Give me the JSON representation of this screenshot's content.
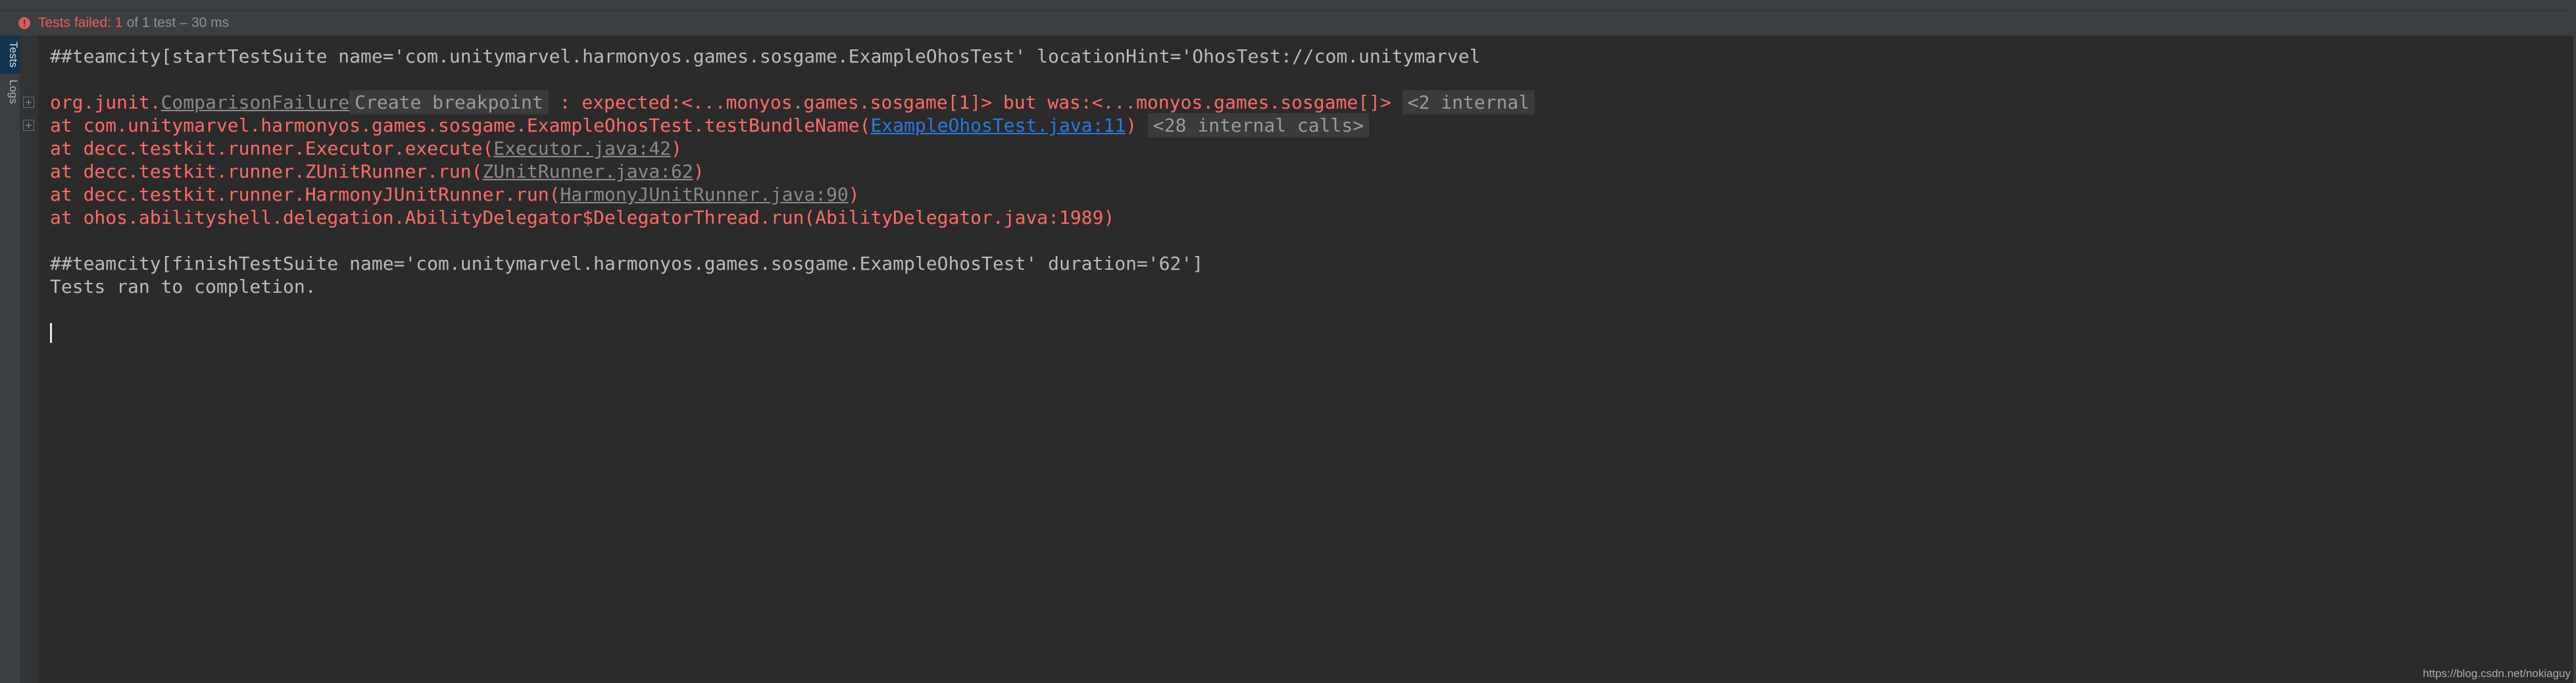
{
  "status": {
    "icon": "error-circle-icon",
    "failed_label": "Tests failed:",
    "count": "1",
    "of_label": "of 1 test",
    "dash": "–",
    "duration": "30 ms"
  },
  "tool_strip": {
    "tabs": [
      {
        "label": "Tests",
        "selected": true
      },
      {
        "label": "Logs",
        "selected": false
      }
    ]
  },
  "console": {
    "lines": [
      {
        "fold": false,
        "segments": [
          {
            "kind": "out",
            "text": "##teamcity[startTestSuite name='com.unitymarvel.harmonyos.games.sosgame.ExampleOhosTest' locationHint='OhosTest://com.unitymarvel"
          }
        ]
      },
      {
        "fold": false,
        "segments": [
          {
            "kind": "blank",
            "text": " "
          }
        ]
      },
      {
        "fold": true,
        "segments": [
          {
            "kind": "err",
            "text": "org.junit."
          },
          {
            "kind": "exc",
            "text": "ComparisonFailure"
          },
          {
            "kind": "hint",
            "text": "Create breakpoint"
          },
          {
            "kind": "err",
            "text": " : expected:<...monyos.games.sosgame[1]> but was:<...monyos.games.sosgame[]>"
          },
          {
            "kind": "space",
            "text": " "
          },
          {
            "kind": "chip",
            "text": "<2 internal"
          }
        ]
      },
      {
        "fold": true,
        "segments": [
          {
            "kind": "err",
            "text": "at com.unitymarvel.harmonyos.games.sosgame.ExampleOhosTest.testBundleName("
          },
          {
            "kind": "linkblue",
            "text": "ExampleOhosTest.java:11"
          },
          {
            "kind": "err",
            "text": ")"
          },
          {
            "kind": "space",
            "text": " "
          },
          {
            "kind": "chip",
            "text": "<28 internal calls>"
          }
        ]
      },
      {
        "fold": false,
        "segments": [
          {
            "kind": "err",
            "text": "at decc.testkit.runner.Executor.execute("
          },
          {
            "kind": "link",
            "text": "Executor.java:42"
          },
          {
            "kind": "err",
            "text": ")"
          }
        ]
      },
      {
        "fold": false,
        "segments": [
          {
            "kind": "err",
            "text": "at decc.testkit.runner.ZUnitRunner.run("
          },
          {
            "kind": "link",
            "text": "ZUnitRunner.java:62"
          },
          {
            "kind": "err",
            "text": ")"
          }
        ]
      },
      {
        "fold": false,
        "segments": [
          {
            "kind": "err",
            "text": "at decc.testkit.runner.HarmonyJUnitRunner.run("
          },
          {
            "kind": "link",
            "text": "HarmonyJUnitRunner.java:90"
          },
          {
            "kind": "err",
            "text": ")"
          }
        ]
      },
      {
        "fold": false,
        "segments": [
          {
            "kind": "err",
            "text": "at ohos.abilityshell.delegation.AbilityDelegator$DelegatorThread.run(AbilityDelegator.java:1989)"
          }
        ]
      },
      {
        "fold": false,
        "segments": [
          {
            "kind": "blank",
            "text": " "
          }
        ]
      },
      {
        "fold": false,
        "segments": [
          {
            "kind": "out",
            "text": "##teamcity[finishTestSuite name='com.unitymarvel.harmonyos.games.sosgame.ExampleOhosTest' duration='62']"
          }
        ]
      },
      {
        "fold": false,
        "segments": [
          {
            "kind": "out",
            "text": "Tests ran to completion."
          }
        ]
      },
      {
        "fold": false,
        "segments": [
          {
            "kind": "blank",
            "text": " "
          }
        ]
      },
      {
        "fold": false,
        "segments": [
          {
            "kind": "caret",
            "text": ""
          }
        ]
      }
    ]
  },
  "watermark": {
    "text": "https://blog.csdn.net/nokiaguy"
  },
  "colors": {
    "background": "#2b2b2b",
    "panel": "#3c3f41",
    "gutter": "#313335",
    "error": "#ff6b68",
    "output": "#bbbbbb",
    "muted": "#8a8a8a",
    "link": "#287bde",
    "selected_tab": "#12344f"
  }
}
